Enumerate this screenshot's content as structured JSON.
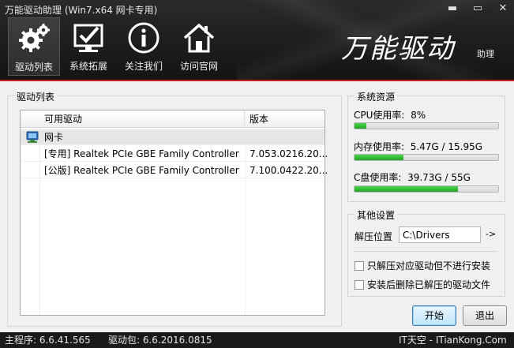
{
  "window": {
    "title": "万能驱动助理 (Win7.x64 网卡专用)",
    "minimize_glyph": "▬",
    "close_glyph": "✕"
  },
  "nav": [
    {
      "label": "驱动列表",
      "icon": "gear-icon",
      "active": true
    },
    {
      "label": "系统拓展",
      "icon": "checkmark-monitor-icon",
      "active": false
    },
    {
      "label": "关注我们",
      "icon": "info-icon",
      "active": false
    },
    {
      "label": "访问官网",
      "icon": "home-icon",
      "active": false
    }
  ],
  "brand": {
    "title": "万能驱动",
    "subtitle": "助理"
  },
  "driver_list": {
    "group_title": "驱动列表",
    "columns": [
      "可用驱动",
      "版本"
    ],
    "group_label": "网卡",
    "rows": [
      {
        "name": "[专用] Realtek PCIe GBE Family Controller",
        "version": "7.053.0216.20..."
      },
      {
        "name": "[公版] Realtek PCIe GBE Family Controller",
        "version": "7.100.0422.20..."
      }
    ]
  },
  "resources": {
    "group_title": "系统资源",
    "items": [
      {
        "label": "CPU使用率:",
        "value": "8%",
        "fill": 0.08
      },
      {
        "label": "内存使用率:",
        "value": "5.47G / 15.95G",
        "fill": 0.343
      },
      {
        "label": "C盘使用率:",
        "value": "39.73G / 55G",
        "fill": 0.722
      }
    ]
  },
  "settings": {
    "group_title": "其他设置",
    "extract_label": "解压位置",
    "extract_path": "C:\\Drivers",
    "arrow": "->",
    "options": [
      {
        "label": "只解压对应驱动但不进行安装",
        "checked": false
      },
      {
        "label": "安装后删除已解压的驱动文件",
        "checked": false
      }
    ]
  },
  "buttons": {
    "start": "开始",
    "exit": "退出"
  },
  "status": {
    "main_program": "主程序: 6.6.41.565",
    "driver_pack": "驱动包: 6.6.2016.0815",
    "site": "IT天空 - ITianKong.Com"
  },
  "colors": {
    "bar_fill": "#22b022",
    "accent": "#c81e1e",
    "header_bg": "#1c1c1c"
  }
}
